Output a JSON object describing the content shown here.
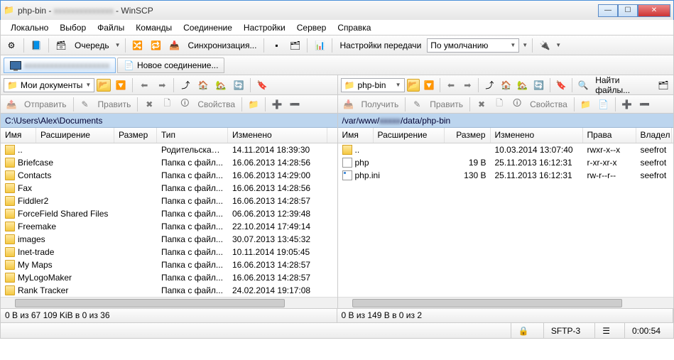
{
  "title": {
    "prefix": "php-bin - ",
    "suffix": " - WinSCP"
  },
  "menu": [
    "Локально",
    "Выбор",
    "Файлы",
    "Команды",
    "Соединение",
    "Настройки",
    "Сервер",
    "Справка"
  ],
  "toolbar1": {
    "queue": "Очередь",
    "sync": "Синхронизация...",
    "transfer_settings": "Настройки передачи",
    "transfer_preset": "По умолчанию"
  },
  "tabs": {
    "new": "Новое соединение..."
  },
  "left": {
    "drive": "Мои документы",
    "path": "C:\\Users\\Alex\\Documents",
    "tb": {
      "send": "Отправить",
      "edit": "Править",
      "props": "Свойства"
    },
    "cols": {
      "name": "Имя",
      "ext": "Расширение",
      "size": "Размер",
      "type": "Тип",
      "modified": "Изменено"
    },
    "colw": {
      "name": 160,
      "size": 60,
      "type": 100,
      "modified": 140
    },
    "rows": [
      {
        "icon": "up",
        "name": "..",
        "type": "Родительская ...",
        "modified": "14.11.2014  18:39:30"
      },
      {
        "icon": "folder",
        "name": "Briefcase",
        "type": "Папка с файл...",
        "modified": "16.06.2013  14:28:56"
      },
      {
        "icon": "folder",
        "name": "Contacts",
        "type": "Папка с файл...",
        "modified": "16.06.2013  14:29:00"
      },
      {
        "icon": "folder",
        "name": "Fax",
        "type": "Папка с файл...",
        "modified": "16.06.2013  14:28:56"
      },
      {
        "icon": "folder",
        "name": "Fiddler2",
        "type": "Папка с файл...",
        "modified": "16.06.2013  14:28:57"
      },
      {
        "icon": "folder",
        "name": "ForceField Shared Files",
        "type": "Папка с файл...",
        "modified": "06.06.2013  12:39:48"
      },
      {
        "icon": "folder",
        "name": "Freemake",
        "type": "Папка с файл...",
        "modified": "22.10.2014  17:49:14"
      },
      {
        "icon": "folder",
        "name": "images",
        "type": "Папка с файл...",
        "modified": "30.07.2013  13:45:32"
      },
      {
        "icon": "folder",
        "name": "Inet-trade",
        "type": "Папка с файл...",
        "modified": "10.11.2014  19:05:45"
      },
      {
        "icon": "folder",
        "name": "My Maps",
        "type": "Папка с файл...",
        "modified": "16.06.2013  14:28:57"
      },
      {
        "icon": "folder",
        "name": "MyLogoMaker",
        "type": "Папка с файл...",
        "modified": "16.06.2013  14:28:57"
      },
      {
        "icon": "folder",
        "name": "Rank Tracker",
        "type": "Папка с файл...",
        "modified": "24.02.2014  19:17:08"
      }
    ],
    "summary": "0 B из 67 109 KiB в 0 из 36"
  },
  "right": {
    "drive": "php-bin",
    "path_pre": "/var/www/",
    "path_post": "/data/php-bin",
    "tb": {
      "get": "Получить",
      "edit": "Править",
      "props": "Свойства",
      "find": "Найти файлы..."
    },
    "cols": {
      "name": "Имя",
      "ext": "Расширение",
      "size": "Размер",
      "modified": "Изменено",
      "rights": "Права",
      "owner": "Владел"
    },
    "colw": {
      "name": 150,
      "size": 65,
      "modified": 130,
      "rights": 75,
      "owner": 50
    },
    "rows": [
      {
        "icon": "up",
        "name": "..",
        "size": "",
        "modified": "10.03.2014 13:07:40",
        "rights": "rwxr-x--x",
        "owner": "seefrot"
      },
      {
        "icon": "file",
        "name": "php",
        "size": "19 B",
        "modified": "25.11.2013 16:12:31",
        "rights": "r-xr-xr-x",
        "owner": "seefrot"
      },
      {
        "icon": "ini",
        "name": "php.ini",
        "size": "130 B",
        "modified": "25.11.2013 16:12:31",
        "rights": "rw-r--r--",
        "owner": "seefrot"
      }
    ],
    "summary": "0 B из 149 B в 0 из 2"
  },
  "status": {
    "proto": "SFTP-3",
    "time": "0:00:54"
  }
}
